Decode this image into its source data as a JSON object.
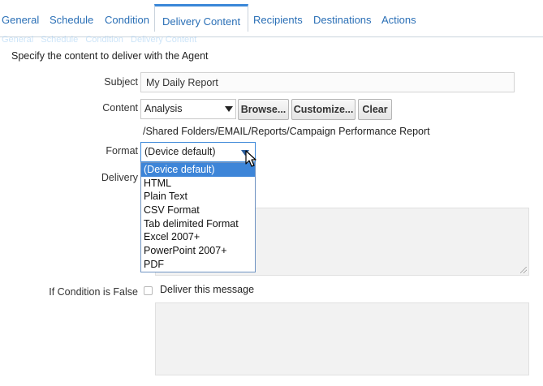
{
  "tabs": [
    {
      "label": "General"
    },
    {
      "label": "Schedule"
    },
    {
      "label": "Condition"
    },
    {
      "label": "Delivery Content",
      "active": true
    },
    {
      "label": "Recipients"
    },
    {
      "label": "Destinations"
    },
    {
      "label": "Actions"
    }
  ],
  "intro": "Specify the content to deliver with the Agent",
  "subject": {
    "label": "Subject",
    "value": "My Daily Report"
  },
  "content": {
    "label": "Content",
    "type_value": "Analysis",
    "browse_label": "Browse...",
    "customize_label": "Customize...",
    "clear_label": "Clear",
    "path": "/Shared Folders/EMAIL/Reports/Campaign Performance Report"
  },
  "format": {
    "label": "Format",
    "selected": "(Device default)",
    "options": [
      "(Device default)",
      "HTML",
      "Plain Text",
      "CSV Format",
      "Tab delimited Format",
      "Excel 2007+",
      "PowerPoint 2007+",
      "PDF"
    ]
  },
  "delivery": {
    "label": "Delivery"
  },
  "if_false": {
    "label": "If Condition is False",
    "checkbox_label": "Deliver this message",
    "checked": false
  },
  "colors": {
    "accent": "#3a87d8",
    "tab_text": "#2a6fb6",
    "selected_option": "#3d85d8"
  }
}
